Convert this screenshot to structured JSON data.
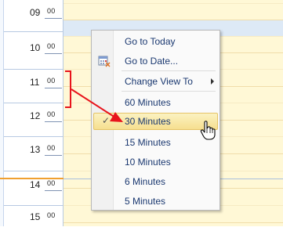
{
  "time_ruler": {
    "rows": [
      {
        "hour": "09",
        "minutes": "00"
      },
      {
        "hour": "10",
        "minutes": "00"
      },
      {
        "hour": "11",
        "minutes": "00"
      },
      {
        "hour": "12",
        "minutes": "00"
      },
      {
        "hour": "13",
        "minutes": "00"
      },
      {
        "hour": "14",
        "minutes": "00"
      },
      {
        "hour": "15",
        "minutes": "00"
      }
    ]
  },
  "context_menu": {
    "items": [
      {
        "label": "Go to Today"
      },
      {
        "label": "Go to Date...",
        "icon": "calendar-icon"
      },
      {
        "label": "Change View To",
        "has_submenu": true
      },
      {
        "label": "60 Minutes"
      },
      {
        "label": "30 Minutes",
        "checked": true,
        "highlighted": true
      },
      {
        "label": "15 Minutes"
      },
      {
        "label": "10 Minutes"
      },
      {
        "label": "6 Minutes"
      },
      {
        "label": "5 Minutes"
      }
    ]
  },
  "colors": {
    "grid_background": "#fff8d6",
    "selection_band": "#dde9f6",
    "current_time_line": "#f0a030",
    "menu_text": "#1a3870",
    "annotation": "#e8141c"
  }
}
